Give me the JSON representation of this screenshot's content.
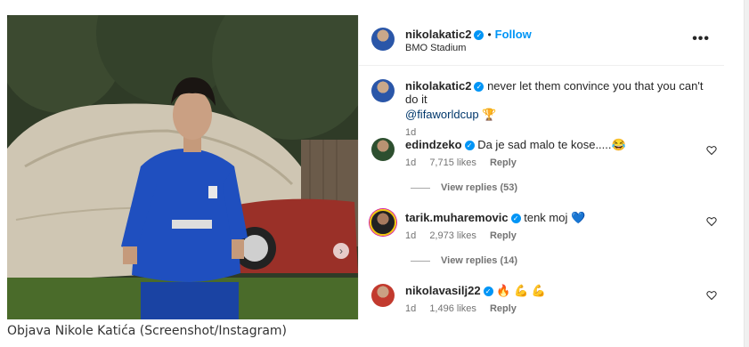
{
  "post": {
    "username": "nikolakatic2",
    "follow_label": "Follow",
    "location": "BMO Stadium",
    "more_label": "•••",
    "caption_text": "never let them convince you that you can't do it",
    "caption_mention": "@fifaworldcup",
    "caption_emoji": "🏆",
    "caption_age": "1d"
  },
  "comments": [
    {
      "username": "edindzeko",
      "text": "Da je sad malo te kose.....",
      "emoji": "😂",
      "age": "1d",
      "likes": "7,715 likes",
      "reply_label": "Reply",
      "view_replies": "View replies (53)"
    },
    {
      "username": "tarik.muharemovic",
      "text": "tenk moj",
      "emoji": "💙",
      "age": "1d",
      "likes": "2,973 likes",
      "reply_label": "Reply",
      "view_replies": "View replies (14)"
    },
    {
      "username": "nikolavasilj22",
      "text": "",
      "emoji": "🔥 💪 💪",
      "age": "1d",
      "likes": "1,496 likes",
      "reply_label": "Reply"
    }
  ],
  "photo": {
    "next_arrow": "›",
    "jersey_text": "",
    "caption": "Objava Nikole Katića (Screenshot/Instagram)"
  },
  "colors": {
    "accent": "#0095f6",
    "jersey": "#1f4fbf",
    "grass": "#4a6b2a"
  }
}
